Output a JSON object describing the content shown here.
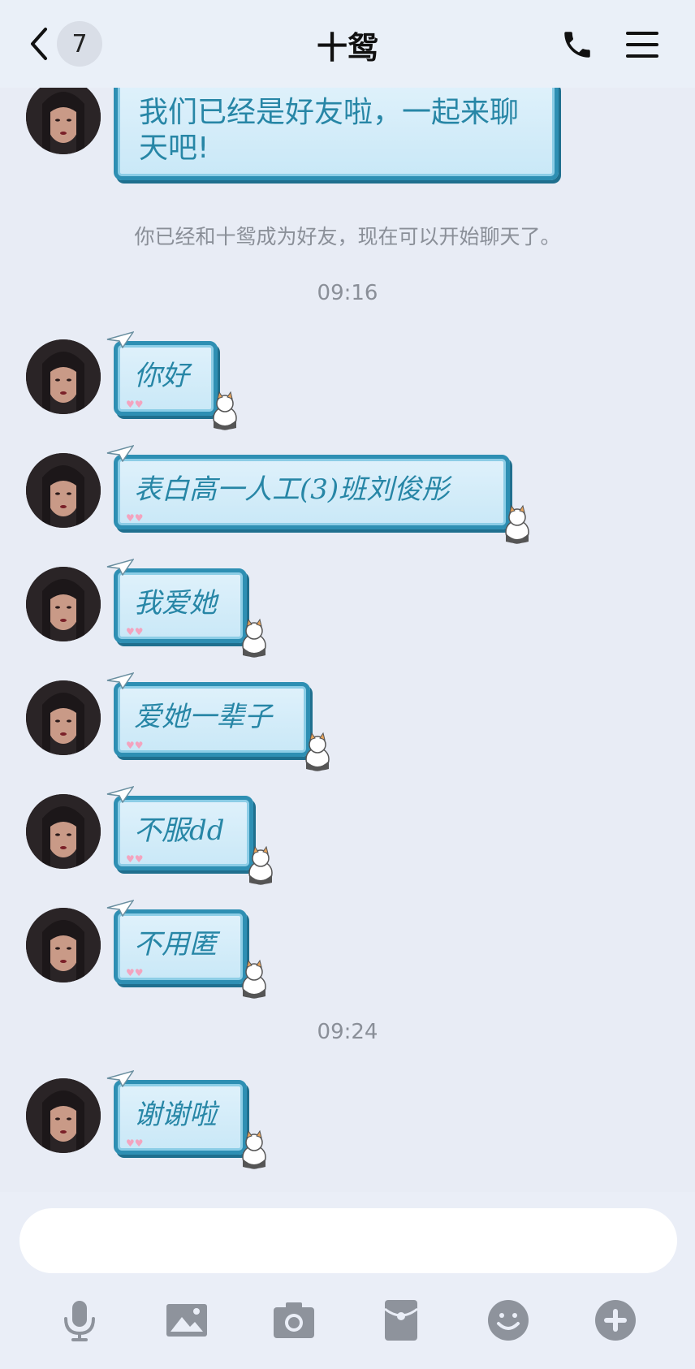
{
  "header": {
    "badge_count": "7",
    "title": "十鸳"
  },
  "chat": {
    "first_message": "我们已经是好友啦，一起来聊天吧!",
    "system_notice": "你已经和十鸳成为好友，现在可以开始聊天了。",
    "time_1": "09:16",
    "messages": [
      {
        "text": "你好"
      },
      {
        "text": "表白高一人工(3)班刘俊彤"
      },
      {
        "text": "我爱她"
      },
      {
        "text": "爱她一辈子"
      },
      {
        "text": "不服dd"
      },
      {
        "text": "不用匿"
      },
      {
        "text": "谢谢啦"
      }
    ],
    "time_2": "09:24"
  },
  "input": {
    "placeholder": ""
  },
  "toolbar": {
    "icons": [
      "microphone-icon",
      "image-icon",
      "camera-icon",
      "red-packet-icon",
      "emoji-icon",
      "plus-icon"
    ]
  },
  "colors": {
    "bubble_border": "#2e8fb3",
    "bubble_text": "#2786a6",
    "background": "#e8ecf5",
    "toolbar_icon": "#8e939c"
  }
}
